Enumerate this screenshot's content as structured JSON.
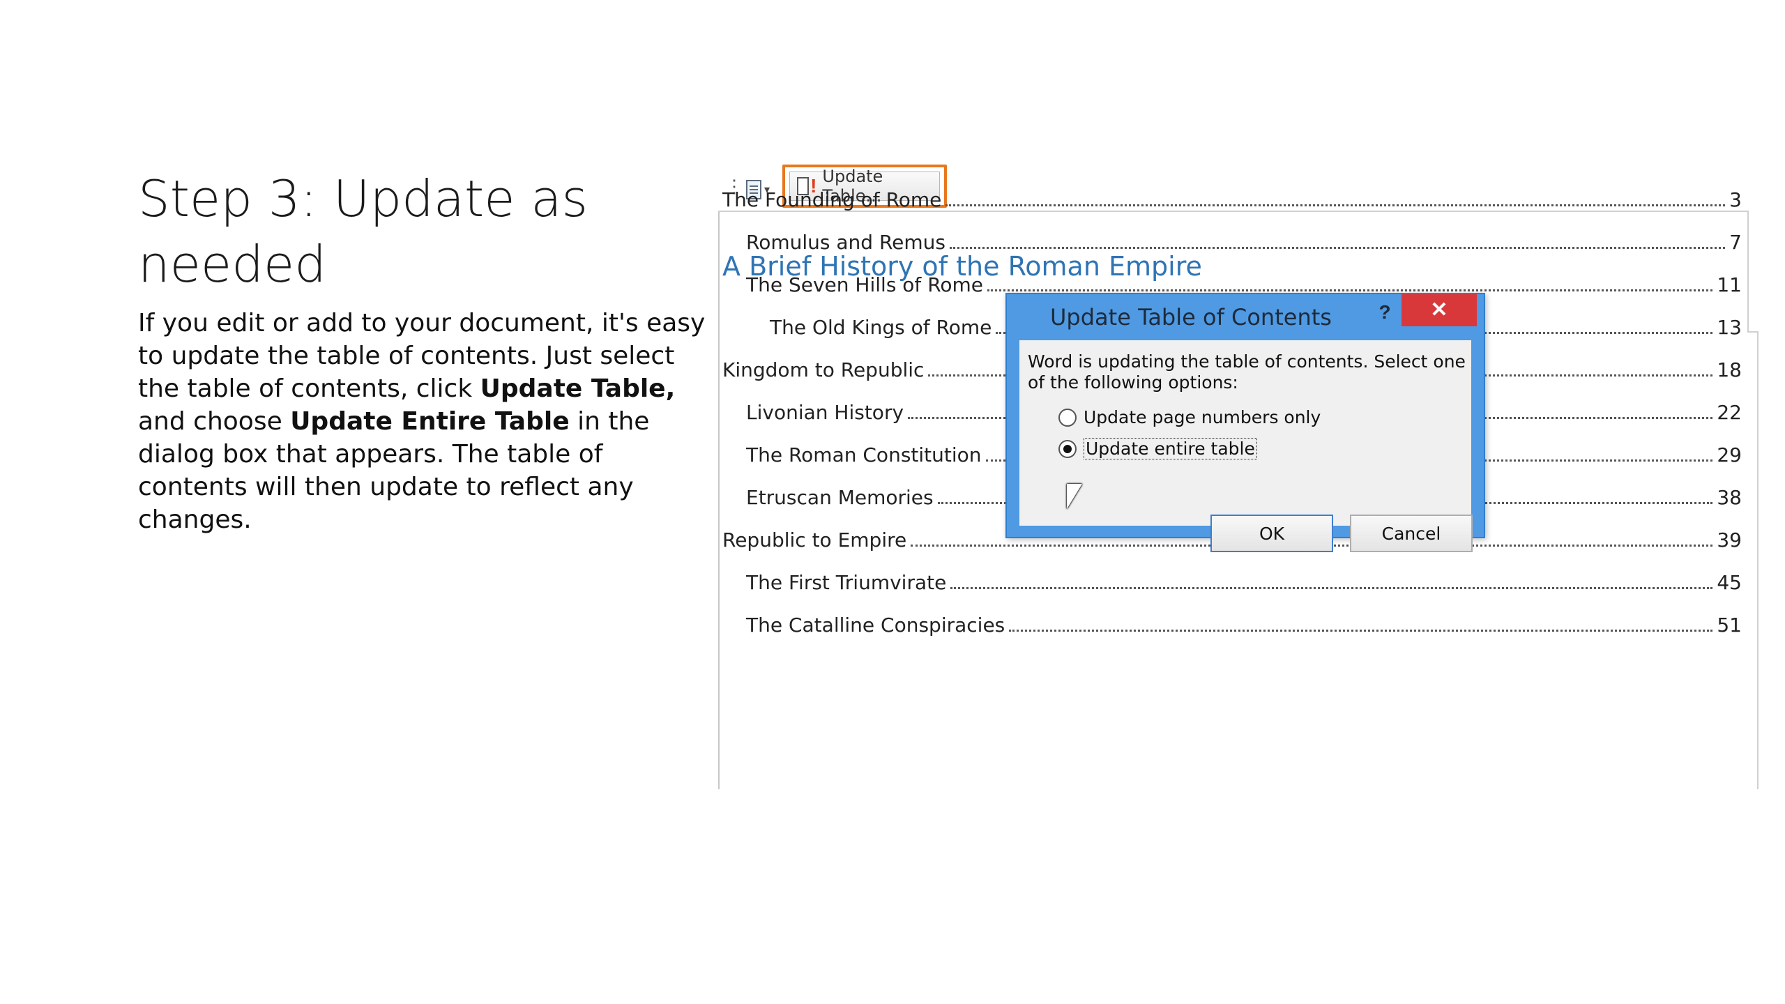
{
  "slide": {
    "title": "Step 3: Update as needed",
    "body_parts": [
      "If you edit or add to your document, it's easy to update the table of contents. Just select the table of contents, click ",
      "Update Table,",
      " and choose ",
      "Update Entire Table",
      " in the dialog box that appears. The table of contents will then update to reflect any changes."
    ]
  },
  "toc_toolbar": {
    "update_button_label": "Update Table...",
    "highlight_color": "#e8781e"
  },
  "document": {
    "heading": "A Brief History of the Roman Empire",
    "heading_color": "#2e74b5",
    "toc_entries": [
      {
        "text": "The Founding of Rome",
        "page": "3",
        "level": 1
      },
      {
        "text": "Romulus and Remus",
        "page": "7",
        "level": 2
      },
      {
        "text": "The Seven Hills of Rome",
        "page": "11",
        "level": 2
      },
      {
        "text": "The Old Kings of Rome",
        "page": "13",
        "level": 3
      },
      {
        "text": "Kingdom to Republic",
        "page": "18",
        "level": 1
      },
      {
        "text": "Livonian History",
        "page": "22",
        "level": 2
      },
      {
        "text": "The Roman Constitution",
        "page": "29",
        "level": 2
      },
      {
        "text": "Etruscan Memories",
        "page": "38",
        "level": 2
      },
      {
        "text": "Republic to Empire",
        "page": "39",
        "level": 1
      },
      {
        "text": "The First Triumvirate",
        "page": "45",
        "level": 2
      },
      {
        "text": "The Catalline Conspiracies",
        "page": "51",
        "level": 2
      }
    ]
  },
  "dialog": {
    "title": "Update Table of Contents",
    "help": "?",
    "close": "✕",
    "message": "Word is updating the table of contents.  Select one of the following options:",
    "options": [
      {
        "label": "Update page numbers only",
        "checked": false
      },
      {
        "label": "Update entire table",
        "checked": true
      }
    ],
    "ok_label": "OK",
    "cancel_label": "Cancel"
  }
}
